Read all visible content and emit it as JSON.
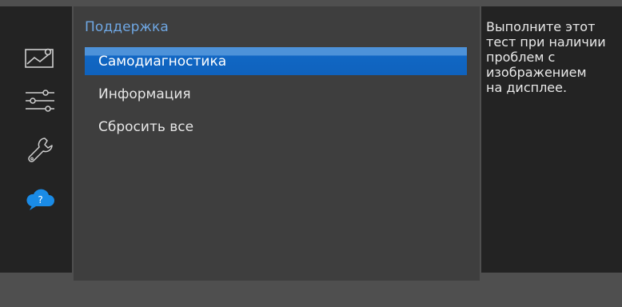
{
  "sidebar": {
    "icons": [
      {
        "name": "picture-icon",
        "active": false
      },
      {
        "name": "sliders-icon",
        "active": false
      },
      {
        "name": "wrench-icon",
        "active": false
      },
      {
        "name": "support-cloud-icon",
        "active": true,
        "glyph": "?"
      }
    ]
  },
  "menu": {
    "title": "Поддержка",
    "items": [
      {
        "label": "Самодиагностика",
        "selected": true
      },
      {
        "label": "Информация",
        "selected": false
      },
      {
        "label": "Сбросить все",
        "selected": false
      }
    ]
  },
  "help": {
    "text": "Выполните этот\nтест при наличии\nпроблем с\nизображением\nна дисплее."
  },
  "colors": {
    "accent": "#1a6fd0",
    "title": "#6fa7e3",
    "icon_inactive": "#cfcfcf",
    "panel_dark": "#232323",
    "panel_mid": "#3e3e3e",
    "background": "#4f4f4f"
  }
}
